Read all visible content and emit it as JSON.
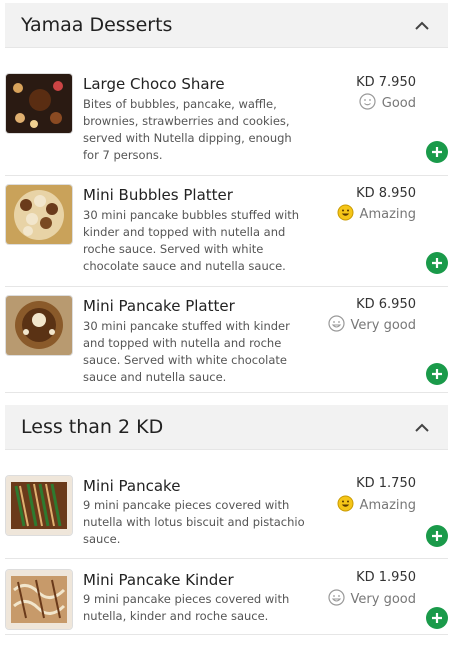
{
  "sections": [
    {
      "title": "Yamaa Desserts",
      "items": [
        {
          "name": "Large Choco Share",
          "description": "Bites of bubbles, pancake, waffle, brownies, strawberries and cookies, served with Nutella dipping, enough for 7 persons.",
          "price": "KD 7.950",
          "rating": "Good",
          "rating_icon": "smiley-outline-icon"
        },
        {
          "name": "Mini Bubbles Platter",
          "description": "30 mini pancake bubbles stuffed with kinder and topped with nutella and roche sauce. Served with white chocolate sauce and nutella sauce.",
          "price": "KD 8.950",
          "rating": "Amazing",
          "rating_icon": "grin-emoji-icon"
        },
        {
          "name": "Mini Pancake Platter",
          "description": "30 mini pancake stuffed with kinder and topped with nutella and roche sauce. Served with white chocolate sauce and nutella sauce.",
          "price": "KD 6.950",
          "rating": "Very good",
          "rating_icon": "smile-outline-icon"
        }
      ]
    },
    {
      "title": "Less than 2 KD",
      "items": [
        {
          "name": "Mini Pancake",
          "description": "9 mini pancake pieces covered with nutella with lotus biscuit and pistachio sauce.",
          "price": "KD 1.750",
          "rating": "Amazing",
          "rating_icon": "grin-emoji-icon"
        },
        {
          "name": "Mini Pancake Kinder",
          "description": "9 mini pancake pieces covered with nutella, kinder and roche sauce.",
          "price": "KD 1.950",
          "rating": "Very good",
          "rating_icon": "smile-outline-icon"
        }
      ]
    }
  ],
  "icons": {
    "collapse": "chevron-up-icon",
    "add": "plus-circle-icon"
  },
  "colors": {
    "add_button": "#1a9a4a",
    "section_bg": "#f2f2f2",
    "emoji": "#f5c518"
  }
}
